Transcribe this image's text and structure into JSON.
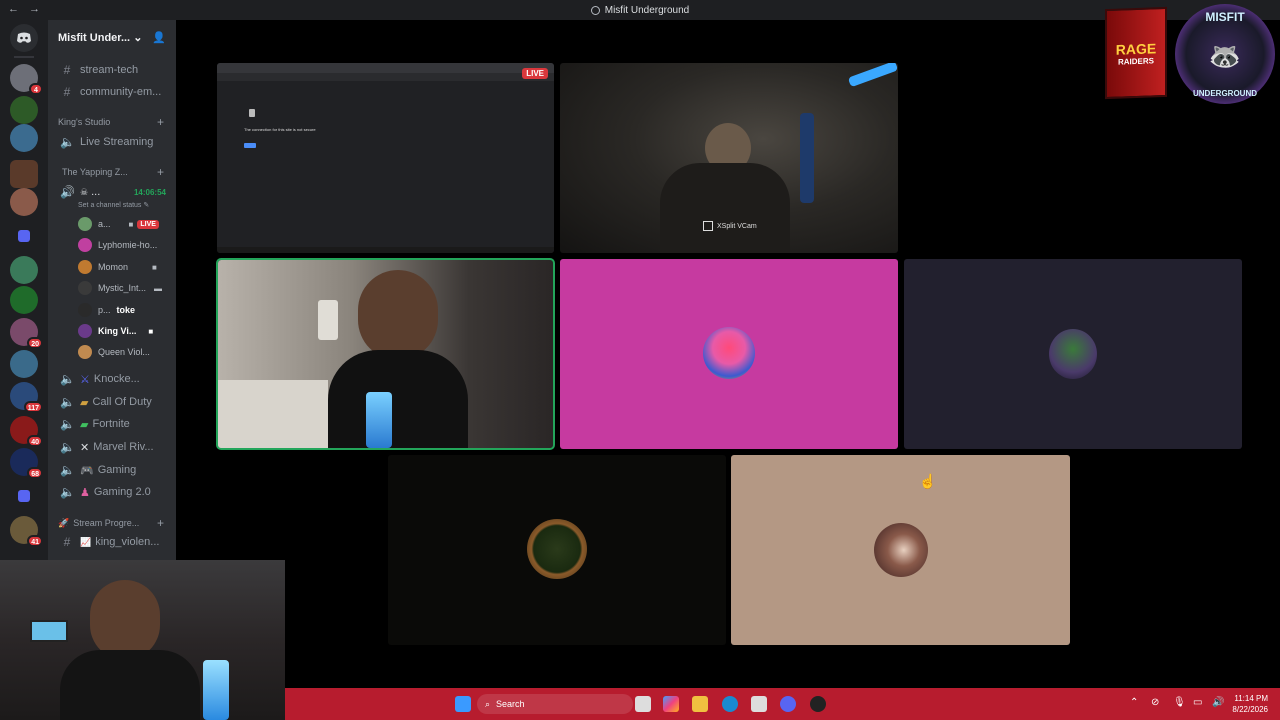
{
  "window": {
    "title": "Misfit Underground",
    "nav_back": "←",
    "nav_fwd": "→"
  },
  "server": {
    "name": "Misfit Under...",
    "chevron": "⌄"
  },
  "channels": {
    "text1": "stream-tech",
    "text2": "community-em...",
    "category1": "King's Studio",
    "live_streaming": "Live Streaming",
    "category2": "The Yapping Z...",
    "active_user": "...",
    "active_timer": "14:06:54",
    "channel_status": "Set a channel status",
    "users": [
      {
        "name": "a...",
        "badge": "LIVE"
      },
      {
        "name": "Lyphomie-ho..."
      },
      {
        "name": "Momon"
      },
      {
        "name": "Mystic_Int..."
      },
      {
        "name": "p...",
        "tag": "toke"
      },
      {
        "name": "King Vi..."
      },
      {
        "name": "Queen Viol..."
      }
    ],
    "voice": [
      "Knocke...",
      "Call Of Duty",
      "Fortnite",
      "Marvel Riv...",
      "Gaming",
      "Gaming 2.0"
    ],
    "category3": "Stream Progre...",
    "text3": "king_violen..."
  },
  "server_badges": [
    "4",
    "20",
    "117",
    "40",
    "68",
    "41"
  ],
  "tiles": {
    "live_label": "LIVE",
    "screen_text": "The connection for this site is not secure",
    "cam_label": "XSplit VCam"
  },
  "overlay": {
    "brand_top": "MISFIT",
    "brand_bottom": "UNDERGROUND",
    "book_line1": "RAGE",
    "book_line2": "RAIDERS"
  },
  "taskbar": {
    "search": "Search",
    "time": "11:14 PM",
    "date": "8/22/2026"
  },
  "colors": {
    "accent": "#5865f2",
    "live": "#da373c",
    "speaking": "#23a55a",
    "taskbar": "#b71c2e"
  }
}
